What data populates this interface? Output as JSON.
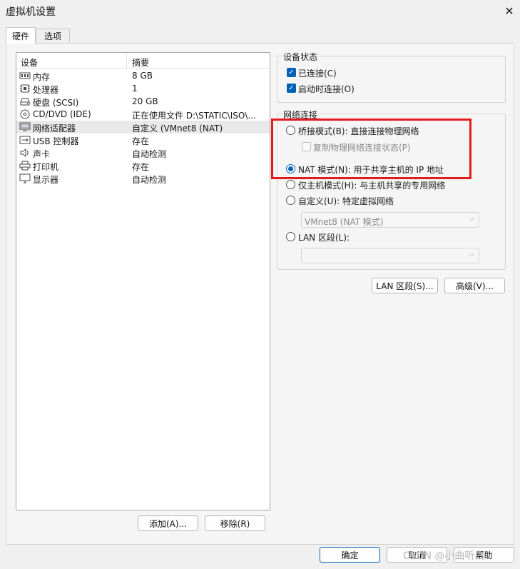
{
  "window": {
    "title": "虚拟机设置",
    "close_glyph": "✕"
  },
  "tabs": [
    {
      "label": "硬件"
    },
    {
      "label": "选项"
    }
  ],
  "device_list": {
    "headers": {
      "device": "设备",
      "summary": "摘要"
    },
    "rows": [
      {
        "name": "内存",
        "value": "8 GB",
        "icon": "memory-icon"
      },
      {
        "name": "处理器",
        "value": "1",
        "icon": "processor-icon"
      },
      {
        "name": "硬盘 (SCSI)",
        "value": "20 GB",
        "icon": "hard-disk-icon"
      },
      {
        "name": "CD/DVD (IDE)",
        "value": "正在使用文件 D:\\STATIC\\ISO\\...",
        "icon": "cd-dvd-icon"
      },
      {
        "name": "网络适配器",
        "value": "自定义 (VMnet8 (NAT)",
        "icon": "network-adapter-icon",
        "selected": true
      },
      {
        "name": "USB 控制器",
        "value": "存在",
        "icon": "usb-icon"
      },
      {
        "name": "声卡",
        "value": "自动检测",
        "icon": "sound-card-icon"
      },
      {
        "name": "打印机",
        "value": "存在",
        "icon": "printer-icon"
      },
      {
        "name": "显示器",
        "value": "自动检测",
        "icon": "display-icon"
      }
    ]
  },
  "buttons": {
    "add": "添加(A)...",
    "remove": "移除(R)",
    "ok": "确定",
    "cancel": "取消",
    "help": "帮助",
    "lan_segments": "LAN 区段(S)...",
    "advanced": "高级(V)..."
  },
  "device_status": {
    "title": "设备状态",
    "connected": {
      "label": "已连接(C)",
      "checked": true
    },
    "connect_at_power_on": {
      "label": "启动时连接(O)",
      "checked": true
    }
  },
  "network_connection": {
    "title": "网络连接",
    "bridged": {
      "label": "桥接模式(B): 直接连接物理网络",
      "selected": false
    },
    "replicate": {
      "label": "复制物理网络连接状态(P)",
      "checked": false,
      "disabled": true
    },
    "nat": {
      "label": "NAT 模式(N): 用于共享主机的 IP 地址",
      "selected": true
    },
    "host_only": {
      "label": "仅主机模式(H): 与主机共享的专用网络",
      "selected": false
    },
    "custom": {
      "label": "自定义(U): 特定虚拟网络",
      "selected": false
    },
    "custom_select_value": "VMnet8 (NAT 模式)",
    "lan_segment": {
      "label": "LAN 区段(L):",
      "selected": false
    },
    "lan_select_value": ""
  },
  "watermark": "CSDN @小曲听白",
  "colors": {
    "accent": "#005fb8",
    "highlight_box": "#e21c1c"
  }
}
